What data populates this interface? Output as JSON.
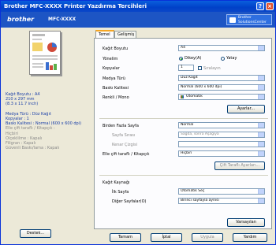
{
  "window": {
    "title": "Brother MFC-XXXX Printer Yazdırma Tercihleri",
    "brand": "brother",
    "model": "MFC-XXXX",
    "solutions_center": "Brother\nSolutionsCenter"
  },
  "tabs": [
    "Temel",
    "Gelişmiş"
  ],
  "summary": {
    "lines": [
      {
        "text": "Kağıt Boyutu : A4",
        "style": "blue"
      },
      {
        "text": "210 x 297 mm",
        "style": "blue"
      },
      {
        "text": "(8.3 x 11.7 inch)",
        "style": "blue"
      },
      {
        "text": "",
        "style": "blue"
      },
      {
        "text": "Medya Türü : Düz Kağıt",
        "style": "blue"
      },
      {
        "text": "Kopyalar : 1",
        "style": "blue"
      },
      {
        "text": "Baskı Kalitesi : Normal (600 x 600 dpi)",
        "style": "blue"
      },
      {
        "text": "Elle çift taraflı / Kitapçık :",
        "style": "gray"
      },
      {
        "text": "Hiçbiri",
        "style": "gray"
      },
      {
        "text": "Ölçeklilme : Kapalı",
        "style": "gray"
      },
      {
        "text": "Filigran : Kapalı",
        "style": "gray"
      },
      {
        "text": "Güvenli Baskı/lama : Kapalı",
        "style": "gray"
      }
    ],
    "default_button": "Destek..."
  },
  "form": {
    "paper_size_label": "Kağıt Boyutu",
    "paper_size_value": "A4",
    "orientation_label": "Yönelim",
    "orientation_portrait": "Dikey(A)",
    "orientation_landscape": "Yatay",
    "copies_label": "Kopyalar",
    "copies_value": "1",
    "collate_label": "Sıralayın",
    "media_label": "Medya Türü",
    "media_value": "Düz Kağıt",
    "quality_label": "Baskı Kalitesi",
    "quality_value": "Normal (600 x 600 dpi)",
    "color_label": "Renkli / Mono",
    "color_value": "Otomatik",
    "settings_button": "Ayarlar...",
    "multipage_label": "Birden Fazla Sayfa",
    "multipage_value": "Normal",
    "page_order_label": "Sayfa Sırası",
    "page_order_value": "Sağda, sonra Aşağıya",
    "border_label": "Kenar Çizgisi",
    "border_value": "",
    "duplex_label": "Elle çift taraflı / Kitapçık",
    "duplex_value": "Hiçbiri",
    "duplex_button": "Çift Taraflı Ayarları...",
    "source_label": "Kağıt Kaynağı",
    "first_page_label": "İlk Sayfa",
    "first_page_value": "Otomatik Seç",
    "other_pages_label": "Diğer Sayfalar(O)",
    "other_pages_value": "Birinci sayfayla aynısı",
    "defaults_button": "Varsayılan"
  },
  "footer": {
    "ok": "Tamam",
    "cancel": "İptal",
    "apply": "Uygula",
    "help": "Yardım"
  }
}
